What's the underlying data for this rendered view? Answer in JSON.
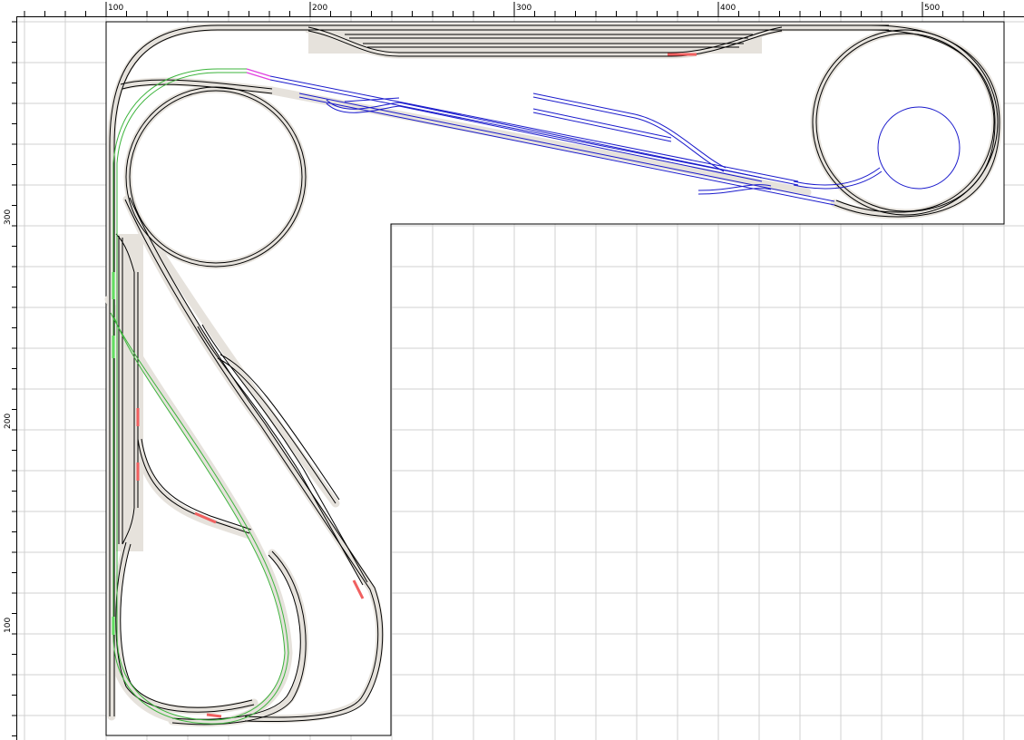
{
  "rulers": {
    "top_labels": [
      "100",
      "200",
      "300",
      "400",
      "500"
    ],
    "left_labels": [
      "300",
      "200",
      "100"
    ]
  },
  "colors": {
    "grid": "#d0d0d0",
    "ballast": "#e6e2dc",
    "track": "#000000",
    "track_green": "#3cb43c",
    "track_blue": "#1a1acc",
    "track_magenta": "#e040e0",
    "highlight_red": "#f06060",
    "board_border": "#000000"
  },
  "layout": {
    "units": "cm",
    "board_shape": "L-shaped"
  }
}
